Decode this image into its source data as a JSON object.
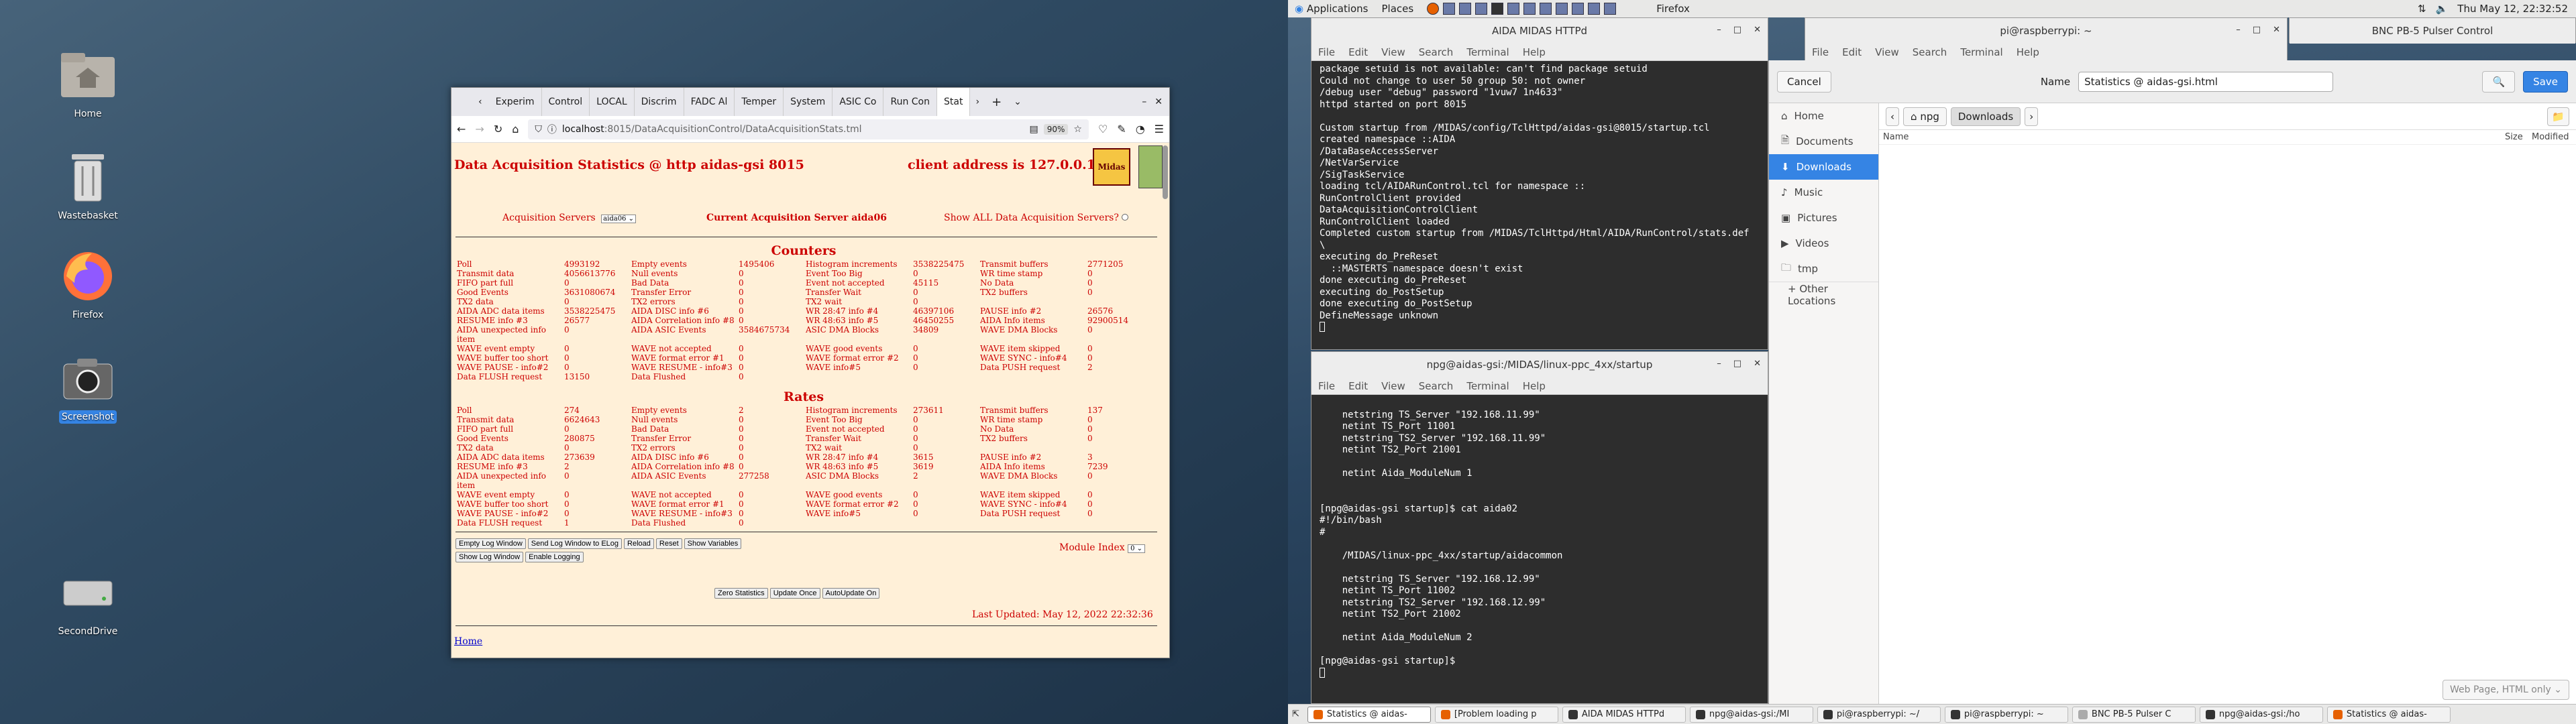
{
  "desktop": {
    "icons": [
      {
        "label": "Home",
        "icon": "home-folder-icon"
      },
      {
        "label": "Wastebasket",
        "icon": "trash-icon"
      },
      {
        "label": "Firefox",
        "icon": "firefox-icon"
      },
      {
        "label": "Screenshot",
        "icon": "camera-icon"
      },
      {
        "label": "SecondDrive",
        "icon": "drive-icon"
      }
    ]
  },
  "topbar": {
    "applications": "Applications",
    "places": "Places",
    "app_name": "Firefox",
    "clock": "Thu May 12, 22:32:52"
  },
  "firefox": {
    "tabs": [
      "Experim",
      "Control",
      "LOCAL",
      "Discrim",
      "FADC Al",
      "Temper",
      "System",
      "ASIC Co",
      "Run Con",
      "Stat"
    ],
    "url_host": "localhost",
    "url_path": ":8015/DataAcquisitionControl/DataAcquisitionStats.tml",
    "zoom": "90%",
    "page": {
      "title": "Data Acquisition Statistics @ http aidas-gsi 8015",
      "client": "client address is 127.0.0.1",
      "logo": "Midas",
      "acq_label": "Acquisition Servers",
      "acq_select": "aida06",
      "current": "Current Acquisition Server aida06",
      "show_all": "Show ALL Data Acquisition Servers?",
      "counters_title": "Counters",
      "rates_title": "Rates",
      "counters": [
        [
          "Poll",
          "4993192",
          "Empty events",
          "1495406",
          "Histogram increments",
          "3538225475",
          "Transmit buffers",
          "2771205"
        ],
        [
          "Transmit data",
          "4056613776",
          "Null events",
          "0",
          "Event Too Big",
          "0",
          "WR time stamp",
          "0"
        ],
        [
          "FIFO part full",
          "0",
          "Bad Data",
          "0",
          "Event not accepted",
          "45115",
          "No Data",
          "0"
        ],
        [
          "Good Events",
          "3631080674",
          "Transfer Error",
          "0",
          "Transfer Wait",
          "0",
          "TX2 buffers",
          "0"
        ],
        [
          "TX2 data",
          "0",
          "TX2 errors",
          "0",
          "TX2 wait",
          "0",
          "",
          ""
        ],
        [
          "AIDA ADC data items",
          "3538225475",
          "AIDA DISC info #6",
          "0",
          "WR 28:47 info #4",
          "46397106",
          "PAUSE info #2",
          "26576"
        ],
        [
          "RESUME info #3",
          "26577",
          "AIDA Correlation info #8",
          "0",
          "WR 48:63 info #5",
          "46450255",
          "AIDA Info items",
          "92900514"
        ],
        [
          "AIDA unexpected info item",
          "0",
          "AIDA ASIC Events",
          "3584675734",
          "ASIC DMA Blocks",
          "34809",
          "WAVE DMA Blocks",
          "0"
        ],
        [
          "WAVE event empty",
          "0",
          "WAVE not accepted",
          "0",
          "WAVE good events",
          "0",
          "WAVE item skipped",
          "0"
        ],
        [
          "WAVE buffer too short",
          "0",
          "WAVE format error #1",
          "0",
          "WAVE format error #2",
          "0",
          "WAVE SYNC - info#4",
          "0"
        ],
        [
          "WAVE PAUSE - info#2",
          "0",
          "WAVE RESUME - info#3",
          "0",
          "WAVE info#5",
          "0",
          "Data PUSH request",
          "2"
        ],
        [
          "Data FLUSH request",
          "13150",
          "Data Flushed",
          "0",
          "",
          "",
          "",
          ""
        ]
      ],
      "rates": [
        [
          "Poll",
          "274",
          "Empty events",
          "2",
          "Histogram increments",
          "273611",
          "Transmit buffers",
          "137"
        ],
        [
          "Transmit data",
          "6624643",
          "Null events",
          "0",
          "Event Too Big",
          "0",
          "WR time stamp",
          "0"
        ],
        [
          "FIFO part full",
          "0",
          "Bad Data",
          "0",
          "Event not accepted",
          "0",
          "No Data",
          "0"
        ],
        [
          "Good Events",
          "280875",
          "Transfer Error",
          "0",
          "Transfer Wait",
          "0",
          "TX2 buffers",
          "0"
        ],
        [
          "TX2 data",
          "0",
          "TX2 errors",
          "0",
          "TX2 wait",
          "0",
          "",
          ""
        ],
        [
          "AIDA ADC data items",
          "273639",
          "AIDA DISC info #6",
          "0",
          "WR 28:47 info #4",
          "3615",
          "PAUSE info #2",
          "3"
        ],
        [
          "RESUME info #3",
          "2",
          "AIDA Correlation info #8",
          "0",
          "WR 48:63 info #5",
          "3619",
          "AIDA Info items",
          "7239"
        ],
        [
          "AIDA unexpected info item",
          "0",
          "AIDA ASIC Events",
          "277258",
          "ASIC DMA Blocks",
          "2",
          "WAVE DMA Blocks",
          "0"
        ],
        [
          "WAVE event empty",
          "0",
          "WAVE not accepted",
          "0",
          "WAVE good events",
          "0",
          "WAVE item skipped",
          "0"
        ],
        [
          "WAVE buffer too short",
          "0",
          "WAVE format error #1",
          "0",
          "WAVE format error #2",
          "0",
          "WAVE SYNC - info#4",
          "0"
        ],
        [
          "WAVE PAUSE - info#2",
          "0",
          "WAVE RESUME - info#3",
          "0",
          "WAVE info#5",
          "0",
          "Data PUSH request",
          "0"
        ],
        [
          "Data FLUSH request",
          "1",
          "Data Flushed",
          "0",
          "",
          "",
          "",
          ""
        ]
      ],
      "buttons_row1": [
        "Empty Log Window",
        "Send Log Window to ELog",
        "Reload",
        "Reset",
        "Show Variables"
      ],
      "buttons_row2": [
        "Show Log Window",
        "Enable Logging"
      ],
      "module_index_label": "Module Index",
      "module_index_value": "0",
      "buttons_row3": [
        "Zero Statistics",
        "Update Once",
        "AutoUpdate On"
      ],
      "last_updated": "Last Updated: May 12, 2022 22:32:36",
      "home_link": "Home"
    }
  },
  "term1": {
    "title": "AIDA MIDAS HTTPd",
    "menu": [
      "File",
      "Edit",
      "View",
      "Search",
      "Terminal",
      "Help"
    ],
    "lines": [
      "package setuid is not available: can't find package setuid",
      "Could not change to user 50 group 50: not owner",
      "/debug user \"debug\" password \"1vuw7 1n4633\"",
      "httpd started on port 8015",
      "",
      "Custom startup from /MIDAS/config/TclHttpd/aidas-gsi@8015/startup.tcl",
      "created namespace ::AIDA",
      "/DataBaseAccessServer",
      "/NetVarService",
      "/SigTaskService",
      "loading tcl/AIDARunControl.tcl for namespace ::",
      "RunControlClient provided",
      "DataAcquisitionControlClient",
      "RunControlClient loaded",
      "Completed custom startup from /MIDAS/TclHttpd/Html/AIDA/RunControl/stats.def",
      "\\",
      "executing do_PreReset",
      "  ::MASTERTS namespace doesn't exist",
      "done executing do_PreReset",
      "executing do_PostSetup",
      "done executing do_PostSetup",
      "DefineMessage unknown"
    ]
  },
  "term2": {
    "title": "npg@aidas-gsi:/MIDAS/linux-ppc_4xx/startup",
    "menu": [
      "File",
      "Edit",
      "View",
      "Search",
      "Terminal",
      "Help"
    ],
    "lines": [
      "",
      "    netstring TS_Server \"192.168.11.99\"",
      "    netint TS_Port 11001",
      "    netstring TS2_Server \"192.168.11.99\"",
      "    netint TS2_Port 21001",
      "",
      "    netint Aida_ModuleNum 1",
      "",
      "",
      "[npg@aidas-gsi startup]$ cat aida02",
      "#!/bin/bash",
      "#",
      "",
      "    /MIDAS/linux-ppc_4xx/startup/aidacommon",
      "",
      "    netstring TS_Server \"192.168.12.99\"",
      "    netint TS_Port 11002",
      "    netstring TS2_Server \"192.168.12.99\"",
      "    netint TS2_Port 21002",
      "",
      "    netint Aida_ModuleNum 2",
      "",
      "[npg@aidas-gsi startup]$ "
    ]
  },
  "term3": {
    "title": "pi@raspberrypi: ~",
    "menu": [
      "File",
      "Edit",
      "View",
      "Search",
      "Terminal",
      "Help"
    ]
  },
  "pulser": {
    "title": "BNC PB-5 Pulser Control"
  },
  "save_dialog": {
    "cancel": "Cancel",
    "name_label": "Name",
    "name_value": "Statistics @ aidas-gsi.html",
    "save": "Save",
    "path": [
      "npg",
      "Downloads"
    ],
    "sidebar": [
      "Home",
      "Documents",
      "Downloads",
      "Music",
      "Pictures",
      "Videos",
      "tmp",
      "+ Other Locations"
    ],
    "columns": [
      "Name",
      "Size",
      "Modified"
    ],
    "filter": "Web Page, HTML only"
  },
  "taskbar": [
    {
      "label": "Statistics @ aidas-",
      "color": "#e66000"
    },
    {
      "label": "[Problem loading p",
      "color": "#e66000"
    },
    {
      "label": "AIDA MIDAS HTTPd",
      "color": "#333"
    },
    {
      "label": "npg@aidas-gsi:/MI",
      "color": "#333"
    },
    {
      "label": "pi@raspberrypi: ~/",
      "color": "#333"
    },
    {
      "label": "pi@raspberrypi: ~",
      "color": "#333"
    },
    {
      "label": "BNC PB-5 Pulser C",
      "color": "#aaa"
    },
    {
      "label": "npg@aidas-gsi:/ho",
      "color": "#333"
    },
    {
      "label": "Statistics @ aidas-",
      "color": "#e66000"
    }
  ]
}
